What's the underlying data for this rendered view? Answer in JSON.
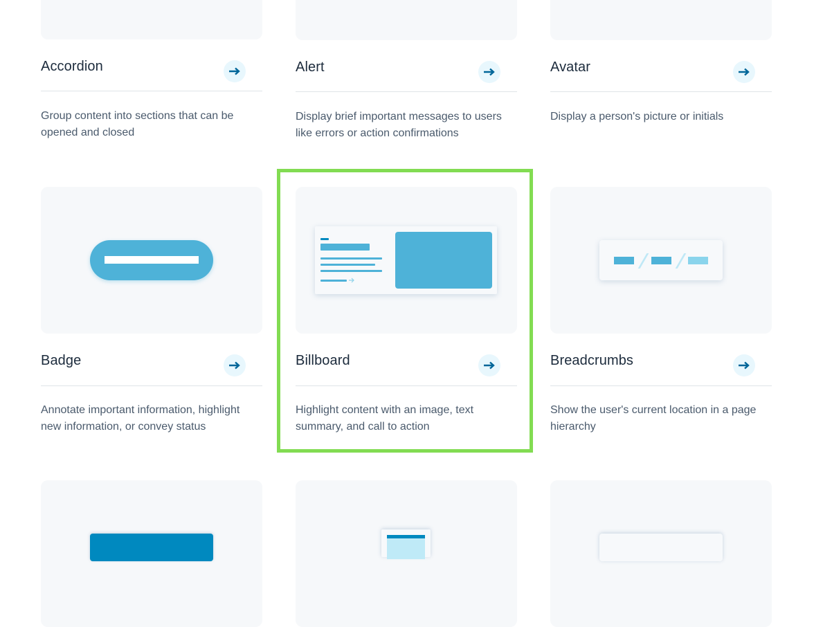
{
  "colors": {
    "accent": "#4eb2d8",
    "accent_dark": "#0089bf",
    "arrow": "#006699",
    "arrow_bg": "#e8f7fd",
    "thumb_bg": "#f6f8fa",
    "highlight": "#82dc52"
  },
  "cards": [
    {
      "title": "Accordion",
      "description": "Group content into sections that can be opened and closed",
      "icon": "arrow-right-icon"
    },
    {
      "title": "Alert",
      "description": "Display brief important messages to users like errors or action confirmations",
      "icon": "arrow-right-icon"
    },
    {
      "title": "Avatar",
      "description": "Display a person's picture or initials",
      "icon": "arrow-right-icon"
    },
    {
      "title": "Badge",
      "description": "Annotate important information, highlight new information, or convey status",
      "icon": "arrow-right-icon"
    },
    {
      "title": "Billboard",
      "description": "Highlight content with an image, text summary, and call to action",
      "icon": "arrow-right-icon",
      "highlighted": true
    },
    {
      "title": "Breadcrumbs",
      "description": "Show the user's current location in a page hierarchy",
      "icon": "arrow-right-icon"
    }
  ]
}
